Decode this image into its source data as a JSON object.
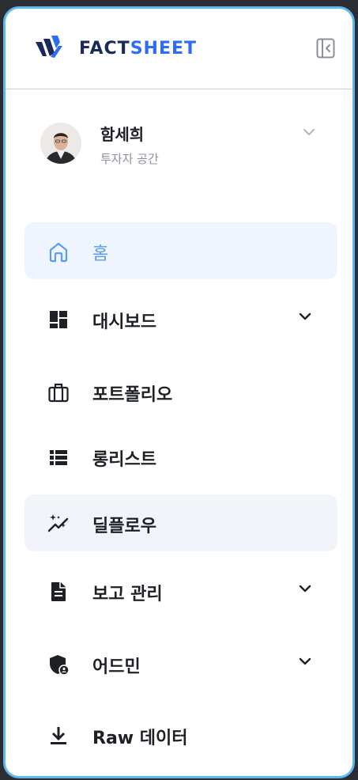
{
  "brand": {
    "prefix": "FACT",
    "accent": "SHEET"
  },
  "profile": {
    "name": "함세희",
    "subtitle": "투자자 공간"
  },
  "nav": {
    "items": [
      {
        "label": "홈",
        "icon": "home-icon",
        "active": true,
        "expandable": false
      },
      {
        "label": "대시보드",
        "icon": "dashboard-icon",
        "active": false,
        "expandable": true
      },
      {
        "label": "포트폴리오",
        "icon": "briefcase-icon",
        "active": false,
        "expandable": false
      },
      {
        "label": "롱리스트",
        "icon": "list-icon",
        "active": false,
        "expandable": false
      },
      {
        "label": "딜플로우",
        "icon": "sparkle-trend-icon",
        "active": false,
        "expandable": false,
        "hovered": true
      },
      {
        "label": "보고 관리",
        "icon": "document-icon",
        "active": false,
        "expandable": true
      },
      {
        "label": "어드민",
        "icon": "admin-shield-icon",
        "active": false,
        "expandable": true
      },
      {
        "label": "Raw 데이터",
        "icon": "download-icon",
        "active": false,
        "expandable": false
      }
    ]
  },
  "colors": {
    "frame_border": "#5cb8ef",
    "brand_dark": "#1b2a5c",
    "brand_accent": "#2d6cf6",
    "active_bg": "#eef5ff",
    "active_text": "#5a9cf0",
    "hover_bg": "#f1f4f8"
  }
}
